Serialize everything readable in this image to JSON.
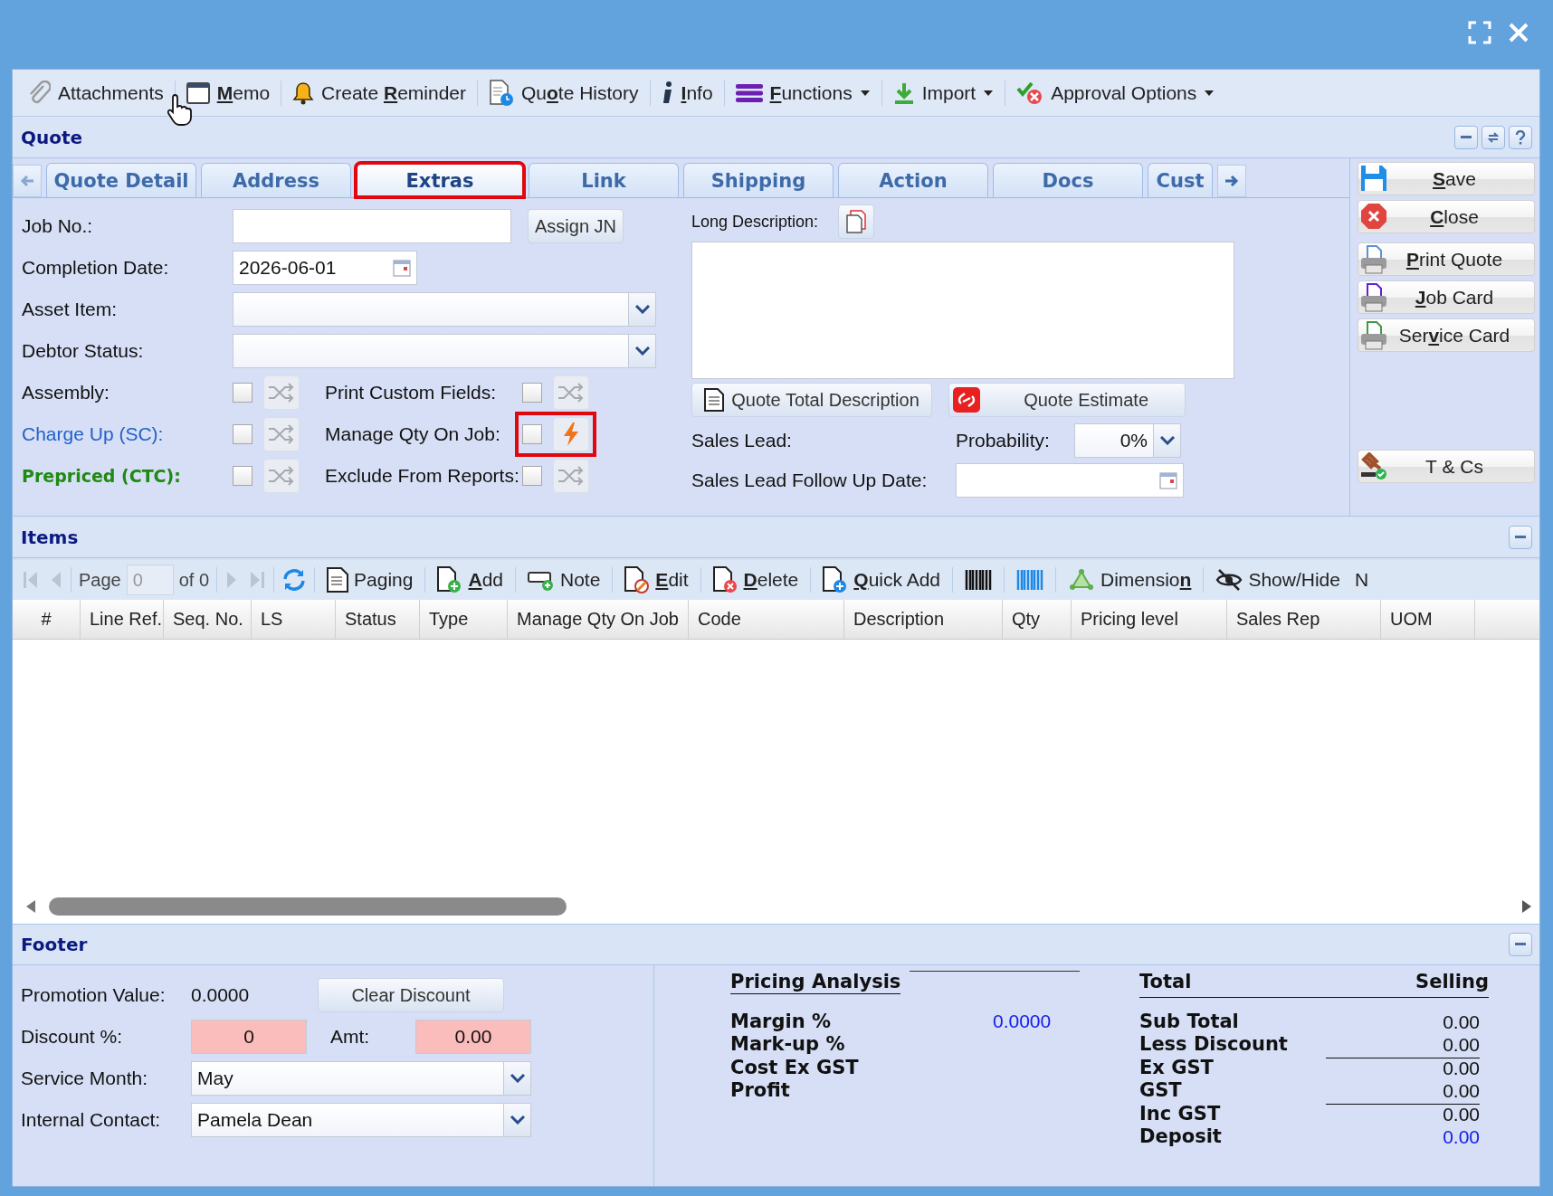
{
  "toolbar": [
    {
      "label": {
        "post": "Attachments"
      },
      "dropdown": false,
      "cursor": true
    },
    {
      "label": {
        "key": "M",
        "post": "emo"
      },
      "dropdown": false,
      "cursor": false
    },
    {
      "label": {
        "pre": "Create ",
        "key": "R",
        "post": "eminder"
      },
      "dropdown": false,
      "cursor": false
    },
    {
      "label": {
        "pre": "Qu",
        "key": "o",
        "post": "te History"
      },
      "dropdown": false,
      "cursor": false
    },
    {
      "label": {
        "key": "I",
        "post": "nfo"
      },
      "dropdown": false,
      "cursor": false
    },
    {
      "label": {
        "key": "F",
        "post": "unctions"
      },
      "dropdown": true,
      "cursor": false
    },
    {
      "label": {
        "post": "Import"
      },
      "dropdown": true,
      "cursor": false
    },
    {
      "label": {
        "post": "Approval Options"
      },
      "dropdown": true,
      "cursor": false
    }
  ],
  "quote": {
    "title": "Quote",
    "tabs": [
      {
        "label": "Quote Detail",
        "selected": false,
        "highlighted": false
      },
      {
        "label": "Address",
        "selected": false,
        "highlighted": false
      },
      {
        "label": "Extras",
        "selected": true,
        "highlighted": true
      },
      {
        "label": "Link",
        "selected": false,
        "highlighted": false
      },
      {
        "label": "Shipping",
        "selected": false,
        "highlighted": false
      },
      {
        "label": "Action",
        "selected": false,
        "highlighted": false
      },
      {
        "label": "Docs",
        "selected": false,
        "highlighted": false
      },
      {
        "label": "Cust",
        "selected": false,
        "highlighted": false
      }
    ],
    "job_no": {
      "label": "Job No.:",
      "button": "Assign JN"
    },
    "completion_date": {
      "label": "Completion Date:",
      "value": "2026-06-01"
    },
    "asset_item": {
      "label": "Asset Item:"
    },
    "debtor_status": {
      "label": "Debtor Status:"
    },
    "checkbox_rows": [
      [
        {
          "label": "Assembly:",
          "kind": "plain",
          "checked": false,
          "action_enabled": false,
          "highlighted": false
        },
        {
          "label": "Print Custom Fields:",
          "kind": "plain",
          "checked": false,
          "action_enabled": false,
          "highlighted": false
        }
      ],
      [
        {
          "label": "Charge Up (SC):",
          "kind": "link",
          "checked": false,
          "action_enabled": false,
          "highlighted": false
        },
        {
          "label": "Manage Qty On Job:",
          "kind": "plain",
          "checked": false,
          "action_enabled": true,
          "highlighted": true
        }
      ],
      [
        {
          "label": "Prepriced (CTC):",
          "kind": "strong",
          "checked": false,
          "action_enabled": false,
          "highlighted": false
        },
        {
          "label": "Exclude From Reports:",
          "kind": "plain",
          "checked": false,
          "action_enabled": false,
          "highlighted": false
        }
      ]
    ],
    "long_description": {
      "label": "Long Description:"
    },
    "description_buttons": [
      "Quote Total Description",
      "Quote Estimate"
    ],
    "sales_lead": {
      "label": "Sales Lead:"
    },
    "probability": {
      "label": "Probability:",
      "value": "0%"
    },
    "follow_up_date": {
      "label": "Sales Lead Follow Up Date:"
    },
    "side_buttons": [
      [
        {
          "label": {
            "key": "S",
            "post": "ave"
          }
        },
        {
          "label": {
            "key": "C",
            "post": "lose"
          }
        }
      ],
      [
        {
          "label": {
            "key": "P",
            "post": "rint Quote"
          }
        },
        {
          "label": {
            "key": "J",
            "post": "ob Card"
          }
        },
        {
          "label": {
            "pre": "Ser",
            "key": "v",
            "post": "ice Card"
          }
        }
      ],
      [
        {
          "label": {
            "post": "T & Cs"
          }
        }
      ]
    ]
  },
  "items": {
    "title": "Items",
    "page_label": "Page",
    "page_value": "0",
    "of_label": "of 0",
    "buttons": [
      {
        "kind": "text",
        "label": {
          "post": "Paging"
        }
      },
      {
        "kind": "text",
        "label": {
          "key": "A",
          "post": "dd"
        }
      },
      {
        "kind": "text",
        "label": {
          "post": "Note"
        }
      },
      {
        "kind": "text",
        "label": {
          "key": "E",
          "post": "dit"
        }
      },
      {
        "kind": "text",
        "label": {
          "key": "D",
          "post": "elete"
        }
      },
      {
        "kind": "text",
        "label": {
          "key": "Q",
          "post": "uick Add"
        }
      },
      {
        "kind": "icon"
      },
      {
        "kind": "icon"
      },
      {
        "kind": "text",
        "label": {
          "pre": "Dimensio",
          "key": "n"
        }
      },
      {
        "kind": "text",
        "label": {
          "post": "Show/Hide"
        }
      },
      {
        "kind": "text",
        "label": {
          "post": "N"
        }
      }
    ],
    "columns": [
      "#",
      "Line Ref.",
      "Seq. No.",
      "LS",
      "Status",
      "Type",
      "Manage Qty On Job",
      "Code",
      "Description",
      "Qty",
      "Pricing level",
      "Sales Rep",
      "UOM"
    ]
  },
  "footer": {
    "title": "Footer",
    "promotion": {
      "label": "Promotion Value:",
      "value": "0.0000",
      "button": "Clear Discount"
    },
    "discount": {
      "label": "Discount %:",
      "value": "0",
      "warning": true,
      "amt_label": "Amt:",
      "amt_value": "0.00",
      "amt_warning": true
    },
    "service_month": {
      "label": "Service Month:",
      "value": "May"
    },
    "internal_contact": {
      "label": "Internal Contact:",
      "value": "Pamela Dean"
    },
    "pricing": {
      "title": "Pricing Analysis",
      "rows": [
        {
          "label": "Margin %",
          "value": "0.0000"
        },
        {
          "label": "Mark-up %"
        },
        {
          "label": "Cost Ex GST"
        },
        {
          "label": "Profit"
        }
      ]
    },
    "totals": {
      "title": "Total",
      "column": "Selling",
      "rows": [
        {
          "label": "Sub Total",
          "value": "0.00",
          "rule_above": false,
          "linked": false
        },
        {
          "label": "Less Discount",
          "value": "0.00",
          "rule_above": false,
          "linked": false
        },
        {
          "label": "Ex GST",
          "value": "0.00",
          "rule_above": true,
          "linked": false
        },
        {
          "label": "GST",
          "value": "0.00",
          "rule_above": false,
          "linked": false
        },
        {
          "label": "Inc GST",
          "value": "0.00",
          "rule_above": true,
          "linked": false
        },
        {
          "label": "Deposit",
          "value": "0.00",
          "rule_above": false,
          "linked": true
        }
      ]
    }
  }
}
